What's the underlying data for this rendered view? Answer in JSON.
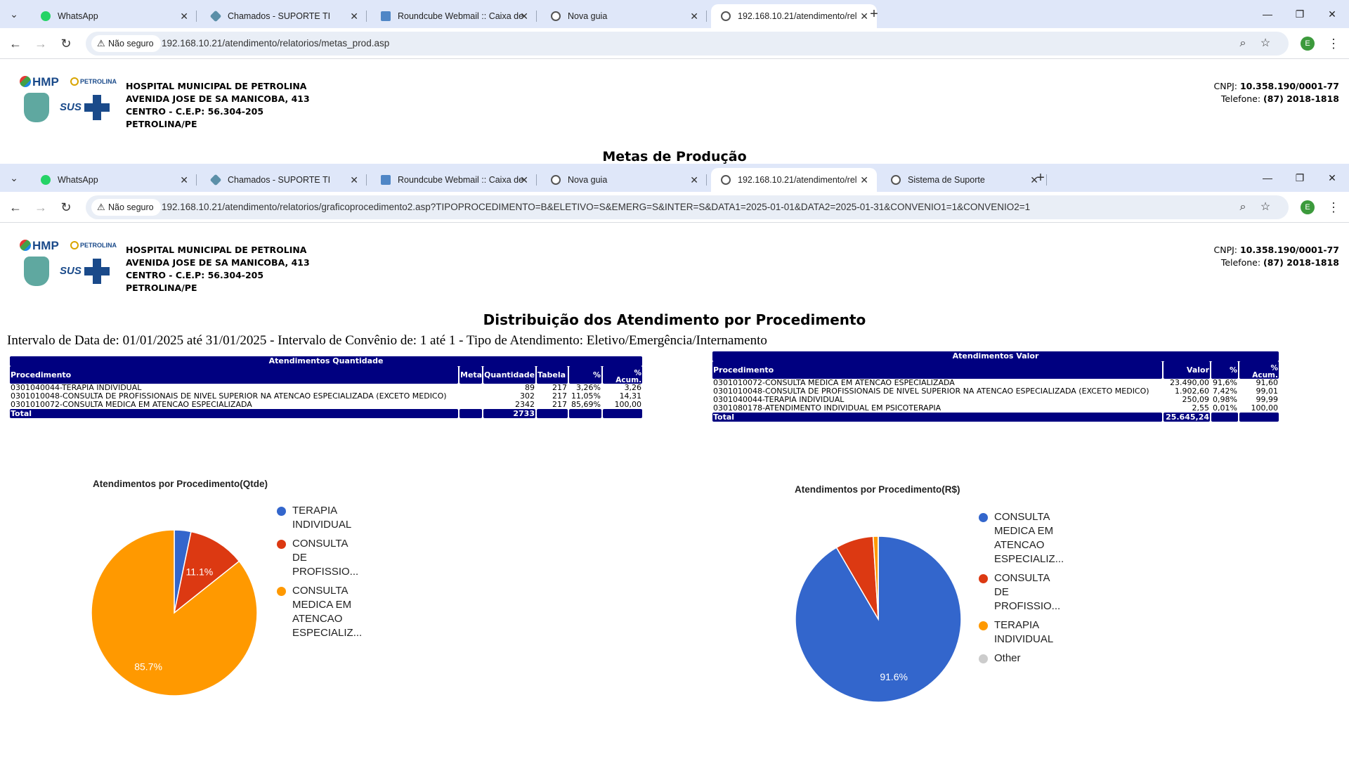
{
  "browser": {
    "back_window": {
      "tabs": [
        {
          "label": "WhatsApp",
          "icon": "whatsapp-icon"
        },
        {
          "label": "Chamados - SUPORTE TI",
          "icon": "support-icon"
        },
        {
          "label": "Roundcube Webmail :: Caixa de",
          "icon": "roundcube-icon"
        },
        {
          "label": "Nova guia",
          "icon": "globe-icon"
        },
        {
          "label": "192.168.10.21/atendimento/rel",
          "icon": "globe-icon",
          "active": true
        }
      ],
      "security_label": "Não seguro",
      "url": "192.168.10.21/atendimento/relatorios/metas_prod.asp"
    },
    "front_window": {
      "tabs": [
        {
          "label": "WhatsApp",
          "icon": "whatsapp-icon"
        },
        {
          "label": "Chamados - SUPORTE TI",
          "icon": "support-icon"
        },
        {
          "label": "Roundcube Webmail :: Caixa de",
          "icon": "roundcube-icon"
        },
        {
          "label": "Nova guia",
          "icon": "globe-icon"
        },
        {
          "label": "192.168.10.21/atendimento/rel",
          "icon": "globe-icon",
          "active": true
        },
        {
          "label": "Sistema de Suporte",
          "icon": "globe-icon"
        }
      ],
      "security_label": "Não seguro",
      "url": "192.168.10.21/atendimento/relatorios/graficoprocedimento2.asp?TIPOPROCEDIMENTO=B&ELETIVO=S&EMERG=S&INTER=S&DATA1=2025-01-01&DATA2=2025-01-31&CONVENIO1=1&CONVENIO2=1"
    },
    "profile_initial": "E"
  },
  "header": {
    "logo": {
      "hmp": "HMP",
      "petrolina": "PETROLINA",
      "sus": "SUS"
    },
    "address_lines": [
      "HOSPITAL MUNICIPAL DE PETROLINA",
      "AVENIDA JOSE DE SA MANICOBA, 413",
      "CENTRO - C.E.P: 56.304-205",
      "PETROLINA/PE"
    ],
    "cnpj_label": "CNPJ:",
    "cnpj_value": "10.358.190/0001-77",
    "phone_label": "Telefone:",
    "phone_value": "(87) 2018-1818"
  },
  "back_page_title": "Metas de Produção",
  "report": {
    "title": "Distribuição dos Atendimento por Procedimento",
    "interval": "Intervalo de Data de: 01/01/2025 até 31/01/2025 - Intervalo de Convênio de: 1 até 1 - Tipo de Atendimento: Eletivo/Emergência/Internamento"
  },
  "table_qty": {
    "caption": "Atendimentos Quantidade",
    "headers": {
      "procedimento": "Procedimento",
      "meta": "Meta",
      "quantidade": "Quantidade",
      "tabela": "Tabela",
      "pct": "%",
      "acum_pct": "%",
      "acum": "Acum."
    },
    "rows": [
      {
        "procedimento": "0301040044-TERAPIA INDIVIDUAL",
        "meta": "",
        "quantidade": "89",
        "tabela": "217",
        "pct": "3,26%",
        "acum": "3,26"
      },
      {
        "procedimento": "0301010048-CONSULTA DE PROFISSIONAIS DE NIVEL SUPERIOR NA ATENCAO ESPECIALIZADA (EXCETO MEDICO)",
        "meta": "",
        "quantidade": "302",
        "tabela": "217",
        "pct": "11,05%",
        "acum": "14,31"
      },
      {
        "procedimento": "0301010072-CONSULTA MEDICA EM ATENCAO ESPECIALIZADA",
        "meta": "",
        "quantidade": "2342",
        "tabela": "217",
        "pct": "85,69%",
        "acum": "100,00"
      }
    ],
    "total_label": "Total",
    "total_quantidade": "2733"
  },
  "table_val": {
    "caption": "Atendimentos Valor",
    "headers": {
      "procedimento": "Procedimento",
      "valor": "Valor",
      "pct": "%",
      "acum_pct": "%",
      "acum": "Acum."
    },
    "rows": [
      {
        "procedimento": "0301010072-CONSULTA MEDICA EM ATENCAO ESPECIALIZADA",
        "valor": "23.490,00",
        "pct": "91,6%",
        "acum": "91,60"
      },
      {
        "procedimento": "0301010048-CONSULTA DE PROFISSIONAIS DE NIVEL SUPERIOR NA ATENCAO ESPECIALIZADA (EXCETO MEDICO)",
        "valor": "1.902,60",
        "pct": "7,42%",
        "acum": "99,01"
      },
      {
        "procedimento": "0301040044-TERAPIA INDIVIDUAL",
        "valor": "250,09",
        "pct": "0,98%",
        "acum": "99,99"
      },
      {
        "procedimento": "0301080178-ATENDIMENTO INDIVIDUAL EM PSICOTERAPIA",
        "valor": "2,55",
        "pct": "0,01%",
        "acum": "100,00"
      }
    ],
    "total_label": "Total",
    "total_valor": "25.645,24"
  },
  "chart_data": [
    {
      "type": "pie",
      "title": "Atendimentos por Procedimento(Qtde)",
      "slices": [
        {
          "label_lines": [
            "TERAPIA",
            "INDIVIDUAL"
          ],
          "value": 89,
          "color": "#3366cc",
          "pct_label": ""
        },
        {
          "label_lines": [
            "CONSULTA",
            "DE",
            "PROFISSIO..."
          ],
          "value": 302,
          "color": "#dc3912",
          "pct_label": "11.1%"
        },
        {
          "label_lines": [
            "CONSULTA",
            "MEDICA EM",
            "ATENCAO",
            "ESPECIALIZ..."
          ],
          "value": 2342,
          "color": "#ff9900",
          "pct_label": "85.7%"
        }
      ],
      "start": "top",
      "legend": "right"
    },
    {
      "type": "pie",
      "title": "Atendimentos por Procedimento(R$)",
      "slices": [
        {
          "label_lines": [
            "CONSULTA",
            "MEDICA EM",
            "ATENCAO",
            "ESPECIALIZ..."
          ],
          "value": 23490.0,
          "color": "#3366cc",
          "pct_label": "91.6%"
        },
        {
          "label_lines": [
            "CONSULTA",
            "DE",
            "PROFISSIO..."
          ],
          "value": 1902.6,
          "color": "#dc3912",
          "pct_label": ""
        },
        {
          "label_lines": [
            "TERAPIA",
            "INDIVIDUAL"
          ],
          "value": 250.09,
          "color": "#ff9900",
          "pct_label": ""
        },
        {
          "label_lines": [
            "Other"
          ],
          "value": 2.55,
          "color": "#cccccc",
          "pct_label": ""
        }
      ],
      "start": "top",
      "legend": "right"
    }
  ]
}
